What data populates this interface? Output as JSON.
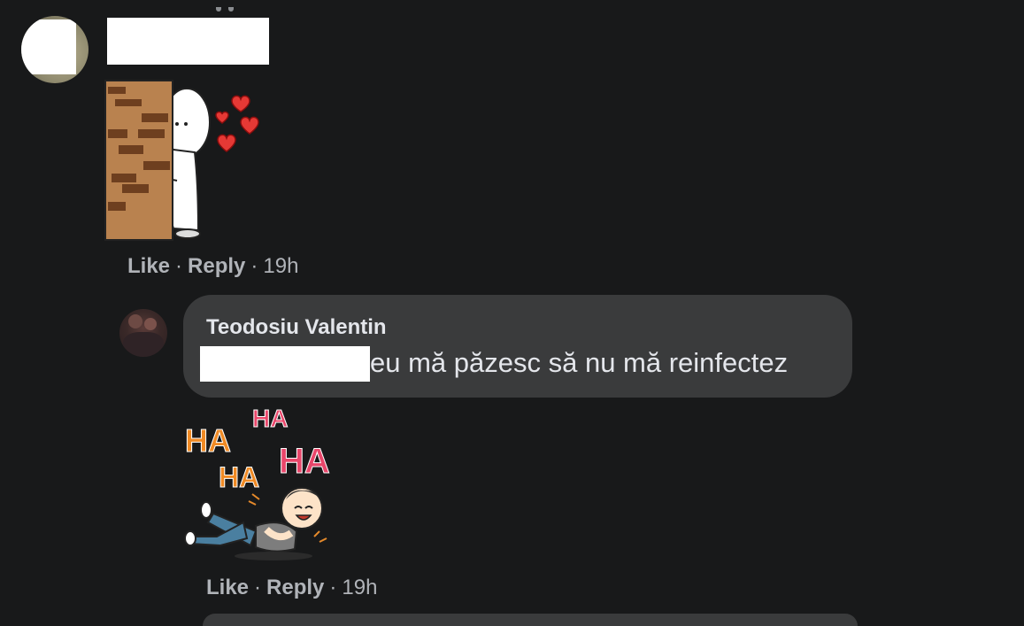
{
  "comment1": {
    "actions": {
      "like": "Like",
      "reply": "Reply",
      "time": "19h",
      "separator": "·"
    }
  },
  "reply1": {
    "author": "Teodosiu Valentin",
    "text": "eu mă păzesc să nu mă reinfectez",
    "sticker_text": [
      "HA",
      "HA",
      "HA",
      "HA"
    ],
    "actions": {
      "like": "Like",
      "reply": "Reply",
      "time": "19h",
      "separator": "·"
    }
  },
  "colors": {
    "background": "#18191a",
    "bubble": "#3a3b3c",
    "primary_text": "#e4e6eb",
    "secondary_text": "#b0b3b8"
  }
}
